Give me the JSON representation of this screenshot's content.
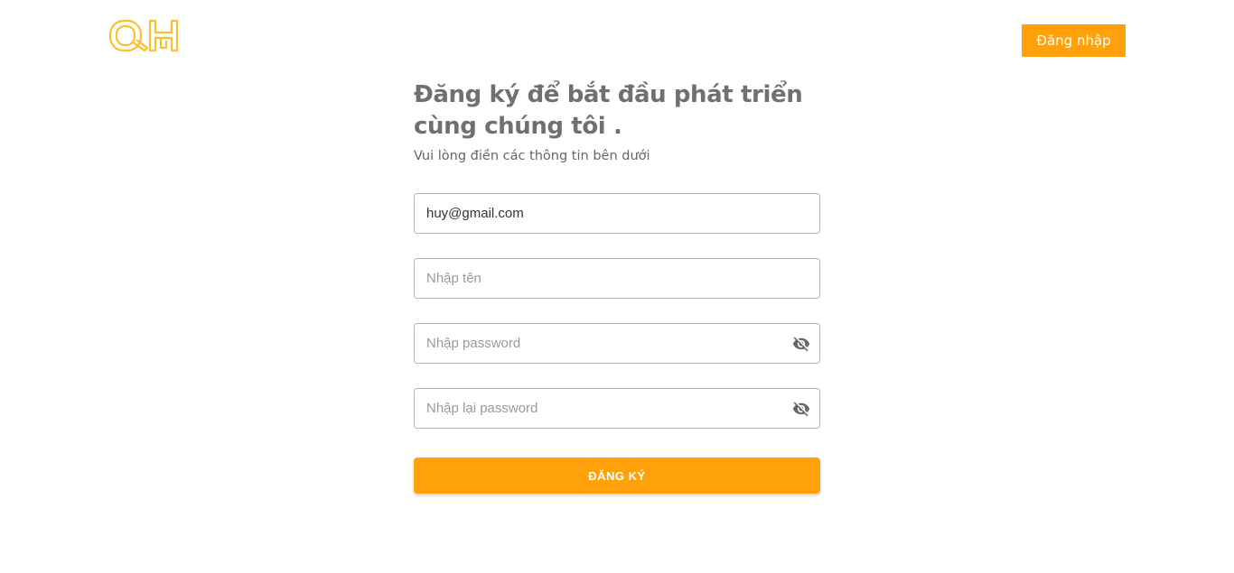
{
  "header": {
    "logo_text": "QH",
    "login_label": "Đăng nhập"
  },
  "form": {
    "title_line1": "Đăng ký để bắt đầu phát triển",
    "title_line2": "cùng chúng tôi .",
    "subtitle": "Vui lòng điền các thông tin bên dưới",
    "email": {
      "value": "huy@gmail.com",
      "placeholder": ""
    },
    "name": {
      "value": "",
      "placeholder": "Nhập tên"
    },
    "password": {
      "value": "",
      "placeholder": "Nhập password"
    },
    "confirm_password": {
      "value": "",
      "placeholder": "Nhập lại password"
    },
    "submit_label": "ĐĂNG KÝ"
  },
  "colors": {
    "accent": "#ffa10a",
    "logo": "#fbc02d",
    "title": "#707070"
  },
  "icons": {
    "logo": "qh-logo-icon",
    "password_toggle": "eye-off-icon"
  }
}
